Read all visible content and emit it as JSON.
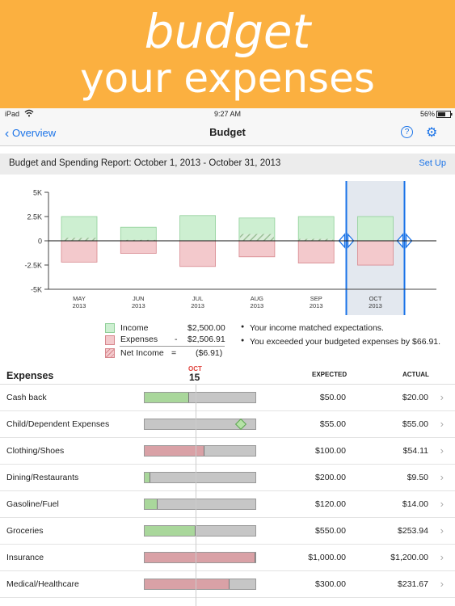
{
  "banner": {
    "line1": "budget",
    "line2": "your expenses"
  },
  "status": {
    "device": "iPad",
    "wifi_icon": "wifi-icon",
    "time": "9:27 AM",
    "battery": "56%",
    "battery_icon": "battery-icon"
  },
  "nav": {
    "back_label": "Overview",
    "title": "Budget",
    "help_glyph": "?",
    "settings_icon": "gear-icon"
  },
  "report": {
    "title": "Budget and Spending Report: October 1, 2013 - October 31, 2013",
    "setup_label": "Set Up"
  },
  "colors": {
    "income": "#CDEFD1",
    "income_border": "#8fcf98",
    "expense": "#F3C9CC",
    "expense_border": "#d7878d",
    "selected": "#E3E8EF",
    "accent": "#1a73e8",
    "green_fill": "#a9d79b",
    "red_fill": "#d9a1a6"
  },
  "chart_data": {
    "type": "bar",
    "categories": [
      "MAY\n2013",
      "JUN\n2013",
      "JUL\n2013",
      "AUG\n2013",
      "SEP\n2013",
      "OCT\n2013"
    ],
    "category_labels": [
      [
        "MAY",
        "2013"
      ],
      [
        "JUN",
        "2013"
      ],
      [
        "JUL",
        "2013"
      ],
      [
        "AUG",
        "2013"
      ],
      [
        "SEP",
        "2013"
      ],
      [
        "OCT",
        "2013"
      ]
    ],
    "series": [
      {
        "name": "Income",
        "values": [
          2500,
          1400,
          2600,
          2350,
          2500,
          2500
        ]
      },
      {
        "name": "Expenses",
        "values": [
          -2200,
          -1300,
          -2650,
          -1650,
          -2300,
          -2506.91
        ]
      },
      {
        "name": "Net Income",
        "values": [
          300,
          100,
          -50,
          700,
          200,
          -6.91
        ]
      }
    ],
    "ytick_labels": [
      "5K",
      "2.5K",
      "0",
      "-2.5K",
      "-5K"
    ],
    "ytick_values": [
      5000,
      2500,
      0,
      -2500,
      -5000
    ],
    "ylim": [
      -5000,
      5000
    ],
    "selected": "OCT 2013"
  },
  "legend": {
    "income_label": "Income",
    "income_value": "$2,500.00",
    "minus": "-",
    "expenses_label": "Expenses",
    "expenses_value": "$2,506.91",
    "equals": "=",
    "net_label": "Net Income",
    "net_value": "($6.91)",
    "note1": "Your income matched expectations.",
    "note2": "You exceeded your budgeted expenses by $66.91."
  },
  "expenses": {
    "title": "Expenses",
    "month": "OCT",
    "day": "15",
    "expected_header": "EXPECTED",
    "actual_header": "ACTUAL",
    "rows": [
      {
        "name": "Cash back",
        "expected": "$50.00",
        "actual": "$20.00",
        "progress": 0.4,
        "kind": "green"
      },
      {
        "name": "Child/Dependent Expenses",
        "expected": "$55.00",
        "actual": "$55.00",
        "progress": 1.0,
        "kind": "diamond"
      },
      {
        "name": "Clothing/Shoes",
        "expected": "$100.00",
        "actual": "$54.11",
        "progress": 0.54,
        "kind": "red"
      },
      {
        "name": "Dining/Restaurants",
        "expected": "$200.00",
        "actual": "$9.50",
        "progress": 0.048,
        "kind": "green"
      },
      {
        "name": "Gasoline/Fuel",
        "expected": "$120.00",
        "actual": "$14.00",
        "progress": 0.117,
        "kind": "green"
      },
      {
        "name": "Groceries",
        "expected": "$550.00",
        "actual": "$253.94",
        "progress": 0.46,
        "kind": "green"
      },
      {
        "name": "Insurance",
        "expected": "$1,000.00",
        "actual": "$1,200.00",
        "progress": 1.0,
        "kind": "red"
      },
      {
        "name": "Medical/Healthcare",
        "expected": "$300.00",
        "actual": "$231.67",
        "progress": 0.77,
        "kind": "red"
      }
    ]
  }
}
